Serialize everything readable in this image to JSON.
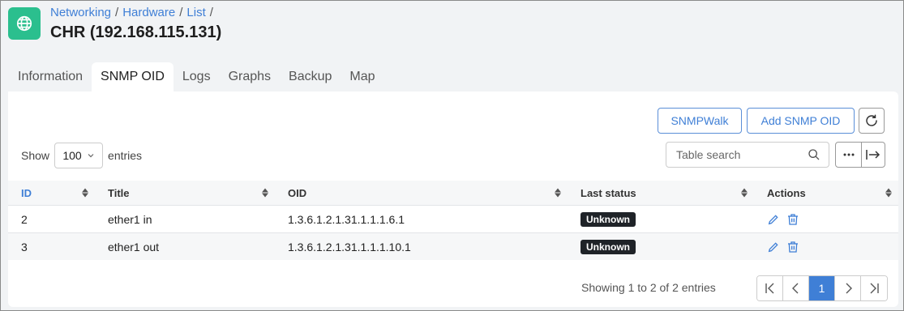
{
  "header": {
    "breadcrumb": [
      "Networking",
      "Hardware",
      "List"
    ],
    "title": "CHR (192.168.115.131)"
  },
  "tabs": [
    {
      "label": "Information"
    },
    {
      "label": "SNMP OID"
    },
    {
      "label": "Logs"
    },
    {
      "label": "Graphs"
    },
    {
      "label": "Backup"
    },
    {
      "label": "Map"
    }
  ],
  "active_tab": "SNMP OID",
  "toolbar": {
    "snmpwalk_label": "SNMPWalk",
    "add_label": "Add SNMP OID",
    "refresh_icon": "refresh-icon"
  },
  "length": {
    "show_label": "Show",
    "value": "100",
    "entries_label": "entries"
  },
  "search": {
    "placeholder": "Table search"
  },
  "table": {
    "columns": [
      "ID",
      "Title",
      "OID",
      "Last status",
      "Actions"
    ],
    "rows": [
      {
        "id": "2",
        "title": "ether1 in",
        "oid": "1.3.6.1.2.1.31.1.1.1.6.1",
        "status": "Unknown"
      },
      {
        "id": "3",
        "title": "ether1 out",
        "oid": "1.3.6.1.2.1.31.1.1.1.10.1",
        "status": "Unknown"
      }
    ]
  },
  "footer": {
    "info": "Showing 1 to 2 of 2 entries",
    "current_page": "1"
  },
  "colors": {
    "accent": "#3f7fd6",
    "brand": "#2bbf8e",
    "badge": "#1f2328"
  }
}
